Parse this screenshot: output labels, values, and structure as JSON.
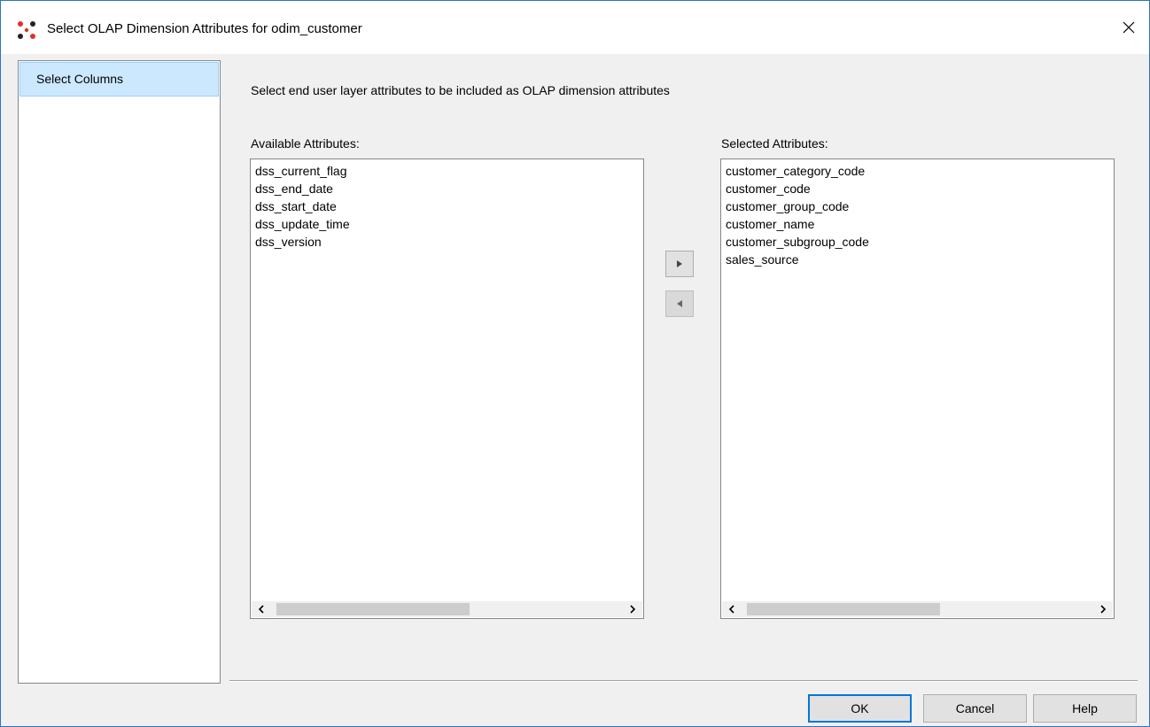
{
  "window": {
    "title": "Select OLAP Dimension Attributes for odim_customer",
    "close_label": "✕"
  },
  "nav": {
    "items": [
      {
        "label": "Select Columns",
        "selected": true
      }
    ]
  },
  "instruction": "Select end user layer attributes to be included as OLAP dimension attributes",
  "available": {
    "label": "Available Attributes:",
    "items": [
      "dss_current_flag",
      "dss_end_date",
      "dss_start_date",
      "dss_update_time",
      "dss_version"
    ]
  },
  "selected": {
    "label": "Selected Attributes:",
    "items": [
      "customer_category_code",
      "customer_code",
      "customer_group_code",
      "customer_name",
      "customer_subgroup_code",
      "sales_source"
    ]
  },
  "move_buttons": {
    "add_icon": "triangle-right-icon",
    "remove_icon": "triangle-left-icon"
  },
  "footer": {
    "ok_label": "OK",
    "cancel_label": "Cancel",
    "help_label": "Help"
  },
  "colors": {
    "selection_bg": "#cce8ff",
    "selection_border": "#99d1ff",
    "default_button_border": "#0078d7",
    "window_border": "#2b74c4"
  }
}
